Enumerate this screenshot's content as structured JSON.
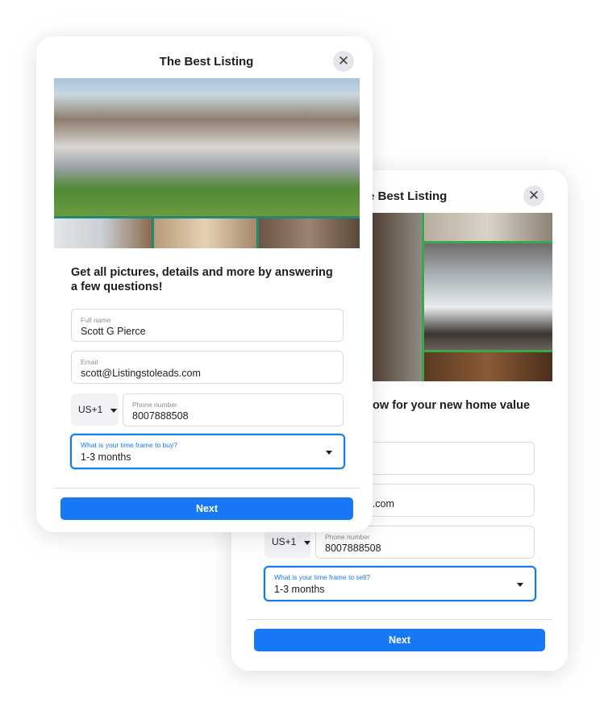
{
  "back_card": {
    "title": "The Best Listing",
    "close_icon": "close-icon",
    "heading_visible": "low for your new home value",
    "email_value": "scott@Listingstoleads.com",
    "country_code": "US+1",
    "phone_label": "Phone number",
    "phone_value": "8007888508",
    "timeframe_label": "What is your time frame to sell?",
    "timeframe_value": "1-3 months",
    "next_label": "Next"
  },
  "front_card": {
    "title": "The Best Listing",
    "close_icon": "close-icon",
    "heading": "Get all pictures, details and more by answering a few questions!",
    "fullname_label": "Full name",
    "fullname_value": "Scott G Pierce",
    "email_label": "Email",
    "email_value": "scott@Listingstoleads.com",
    "country_code": "US+1",
    "phone_label": "Phone number",
    "phone_value": "8007888508",
    "timeframe_label": "What is your time frame to buy?",
    "timeframe_value": "1-3 months",
    "next_label": "Next"
  },
  "colors": {
    "accent": "#1877f2",
    "photo_border_front": "#1f8a70",
    "photo_border_back": "#3aa84a"
  }
}
